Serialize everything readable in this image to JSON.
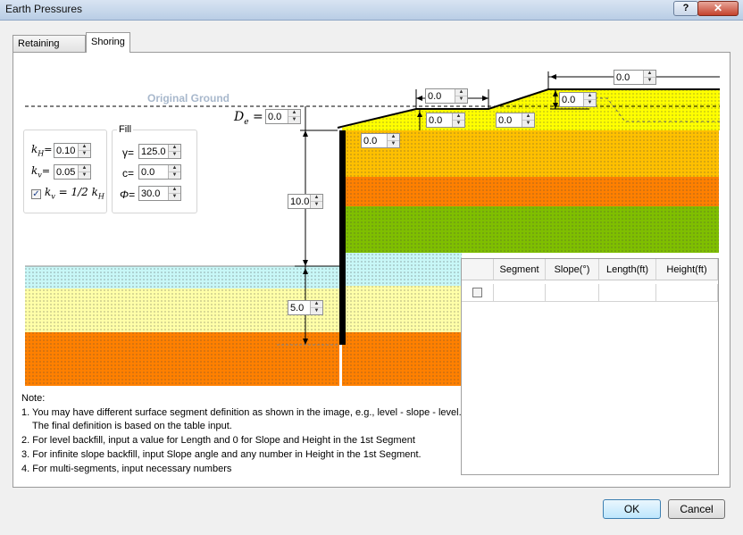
{
  "window": {
    "title": "Earth Pressures",
    "help_glyph": "?",
    "close_glyph": "✕"
  },
  "tabs": [
    {
      "label": "Retaining Wall"
    },
    {
      "label": "Shoring"
    }
  ],
  "diagram": {
    "original_ground_label": "Original Ground",
    "de_label": "D",
    "de_sub": "e",
    "de_eq": "=",
    "de_value": "0.0",
    "top_length_value": "0.0",
    "segment_length_value": "0.0",
    "segment_height_value": "0.0",
    "slope_height_1": "0.0",
    "slope_height_2": "0.0",
    "wall_top_offset": "0.0",
    "excavation_depth": "10.0",
    "embedment_depth": "5.0",
    "colors": {
      "yellow": "#ffff00",
      "light_orange": "#ffc000",
      "orange": "#ff8000",
      "green": "#7fbf00",
      "cyan": "#c8f7f7",
      "pale_yellow": "#ffffa8",
      "wall": "#000000"
    }
  },
  "coefficients": {
    "kh_symbol": "k",
    "kh_sub": "H",
    "kh_eq": "=",
    "kh_value": "0.10",
    "kv_symbol": "k",
    "kv_sub": "v",
    "kv_eq": "=",
    "kv_value": "0.05",
    "link_checked": true,
    "link_label_lhs": "k",
    "link_label_lhs_sub": "v",
    "link_label_mid": " = 1/2 k",
    "link_label_rhs_sub": "H"
  },
  "fill": {
    "legend": "Fill",
    "gamma_label": "γ=",
    "gamma_value": "125.0",
    "c_label": "c=",
    "c_value": "0.0",
    "phi_label": "Φ=",
    "phi_value": "30.0"
  },
  "notes": [
    "Note:",
    "1. You may have different surface segment definition as shown in the image, e.g., level - slope - level...",
    "    The final definition is based on the table input.",
    "2. For level backfill, input a value for Length and 0 for Slope and Height in the 1st Segment",
    "3. For infinite slope backfill, input Slope angle and any number in Height in the 1st Segment.",
    "4. For multi-segments, input necessary numbers"
  ],
  "segment_table": {
    "columns": [
      "",
      "Segment",
      "Slope(°)",
      "Length(ft)",
      "Height(ft)"
    ],
    "rows": [
      {
        "checked": false,
        "segment": "",
        "slope": "",
        "length": "",
        "height": ""
      }
    ]
  },
  "buttons": {
    "ok": "OK",
    "cancel": "Cancel"
  }
}
